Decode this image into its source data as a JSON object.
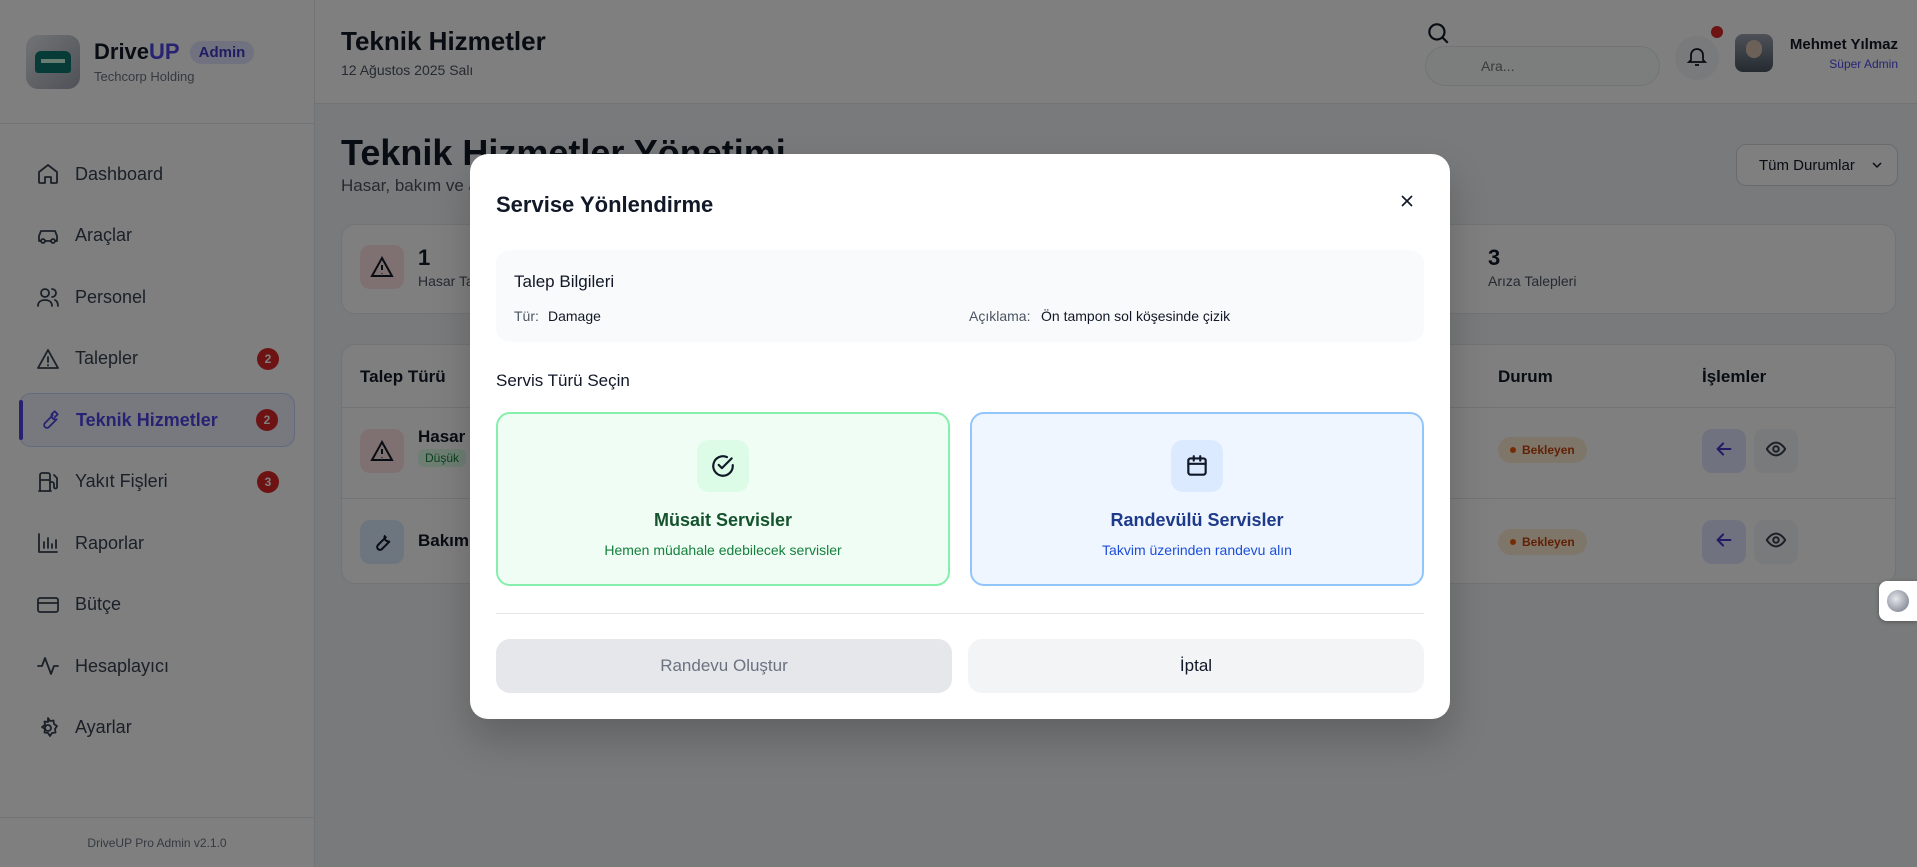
{
  "brand": {
    "name_a": "Drive",
    "name_b": "UP",
    "badge": "Admin",
    "company": "Techcorp Holding"
  },
  "sidebar": {
    "items": [
      {
        "label": "Dashboard",
        "badge": ""
      },
      {
        "label": "Araçlar",
        "badge": ""
      },
      {
        "label": "Personel",
        "badge": ""
      },
      {
        "label": "Talepler",
        "badge": "2"
      },
      {
        "label": "Teknik Hizmetler",
        "badge": "2"
      },
      {
        "label": "Yakıt Fişleri",
        "badge": "3"
      },
      {
        "label": "Raporlar",
        "badge": ""
      },
      {
        "label": "Bütçe",
        "badge": ""
      },
      {
        "label": "Hesaplayıcı",
        "badge": ""
      },
      {
        "label": "Ayarlar",
        "badge": ""
      }
    ],
    "active_index": 4,
    "footer": "DriveUP Pro Admin v2.1.0"
  },
  "header": {
    "title": "Teknik Hizmetler",
    "date": "12 Ağustos 2025 Salı",
    "search_placeholder": "Ara...",
    "user_name": "Mehmet Yılmaz",
    "user_role": "Süper Admin"
  },
  "main": {
    "title": "Teknik Hizmetler Yönetimi",
    "subtitle": "Hasar, bakım ve arıza taleplerini yönetin",
    "status_filter": "Tüm Durumlar",
    "stats": [
      {
        "value": "1",
        "label": "Hasar Talepleri"
      },
      {
        "value": "3",
        "label": "Arıza Talepleri"
      }
    ],
    "table": {
      "headers": [
        "Talep Türü",
        "Durum",
        "İşlemler"
      ],
      "rows": [
        {
          "type": "Hasar",
          "priority": "Düşük",
          "status": "Bekleyen"
        },
        {
          "type": "Bakım",
          "priority": "",
          "status": "Bekleyen"
        }
      ]
    }
  },
  "modal": {
    "title": "Servise Yönlendirme",
    "info_title": "Talep Bilgileri",
    "type_label": "Tür:",
    "type_value": "Damage",
    "desc_label": "Açıklama:",
    "desc_value": "Ön tampon sol köşesinde çizik",
    "section_title": "Servis Türü Seçin",
    "options": [
      {
        "name": "Müsait Servisler",
        "desc": "Hemen müdahale edebilecek servisler",
        "icon": "check-circle-icon"
      },
      {
        "name": "Randevülü Servisler",
        "desc": "Takvim üzerinden randevu alın",
        "icon": "calendar-icon"
      }
    ],
    "create_button": "Randevu Oluştur",
    "cancel_button": "İptal"
  },
  "colors": {
    "accent": "#4f46e5",
    "danger": "#dc2626",
    "success": "#15803d",
    "info": "#1d4ed8"
  }
}
